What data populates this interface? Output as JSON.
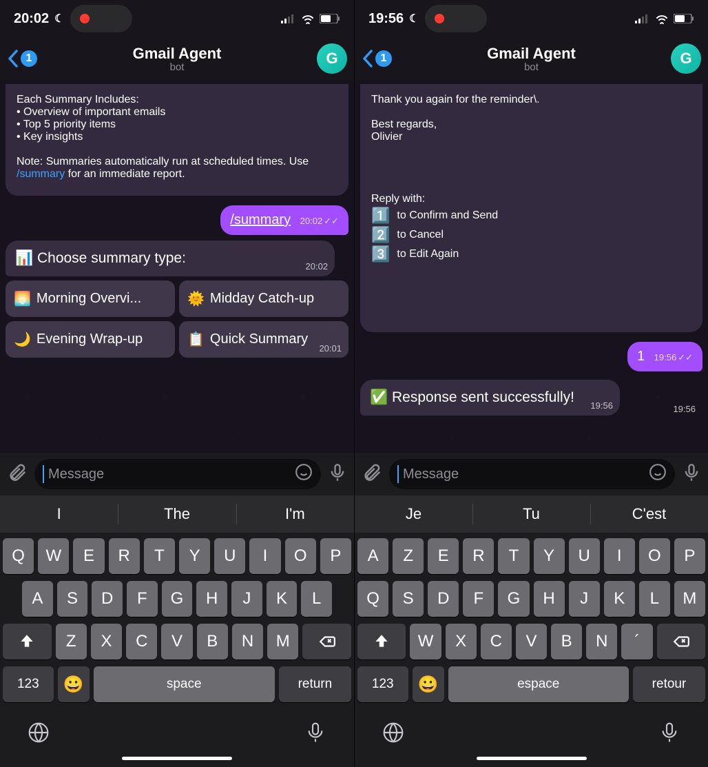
{
  "left": {
    "status": {
      "time": "20:02"
    },
    "nav": {
      "badge": "1",
      "title": "Gmail Agent",
      "subtitle": "bot",
      "avatar_initial": "G"
    },
    "bot_message": {
      "header": "Each Summary Includes:",
      "bullets": [
        "Overview of important emails",
        "Top 5 priority items",
        "Key insights"
      ],
      "note_prefix": "Note: Summaries automatically run at scheduled times. Use ",
      "note_cmd": "/summary",
      "note_suffix": " for an immediate report.",
      "time": "20:01"
    },
    "user_message": {
      "text": "/summary",
      "time": "20:02"
    },
    "choose": {
      "prompt": "📊 Choose summary type:",
      "time": "20:02"
    },
    "quick": [
      {
        "emoji": "🌅",
        "label": "Morning Overvi..."
      },
      {
        "emoji": "🌞",
        "label": "Midday Catch-up"
      },
      {
        "emoji": "🌙",
        "label": "Evening Wrap-up"
      },
      {
        "emoji": "📋",
        "label": "Quick Summary"
      }
    ],
    "input": {
      "placeholder": "Message"
    },
    "suggestions": [
      "I",
      "The",
      "I'm"
    ],
    "kb": {
      "row1": [
        "Q",
        "W",
        "E",
        "R",
        "T",
        "Y",
        "U",
        "I",
        "O",
        "P"
      ],
      "row2": [
        "A",
        "S",
        "D",
        "F",
        "G",
        "H",
        "J",
        "K",
        "L"
      ],
      "row3": [
        "Z",
        "X",
        "C",
        "V",
        "B",
        "N",
        "M"
      ],
      "num": "123",
      "space": "space",
      "return": "return"
    }
  },
  "right": {
    "status": {
      "time": "19:56"
    },
    "nav": {
      "badge": "1",
      "title": "Gmail Agent",
      "subtitle": "bot",
      "avatar_initial": "G"
    },
    "bot_message": {
      "line1": "Thank you again for the reminder\\.",
      "line2": "Best regards,",
      "line3": "Olivier",
      "reply_header": "Reply with:",
      "options": [
        {
          "num": "1️⃣",
          "text": "to Confirm and Send"
        },
        {
          "num": "2️⃣",
          "text": "to Cancel"
        },
        {
          "num": "3️⃣",
          "text": "to Edit Again"
        }
      ],
      "time": "19:56"
    },
    "user_message": {
      "text": "1",
      "time": "19:56"
    },
    "confirm": {
      "emoji": "✅",
      "text": "Response sent successfully!",
      "time": "19:56"
    },
    "input": {
      "placeholder": "Message"
    },
    "suggestions": [
      "Je",
      "Tu",
      "C'est"
    ],
    "kb": {
      "row1": [
        "A",
        "Z",
        "E",
        "R",
        "T",
        "Y",
        "U",
        "I",
        "O",
        "P"
      ],
      "row2": [
        "Q",
        "S",
        "D",
        "F",
        "G",
        "H",
        "J",
        "K",
        "L",
        "M"
      ],
      "row3": [
        "W",
        "X",
        "C",
        "V",
        "B",
        "N",
        "´"
      ],
      "num": "123",
      "space": "espace",
      "return": "retour"
    }
  }
}
